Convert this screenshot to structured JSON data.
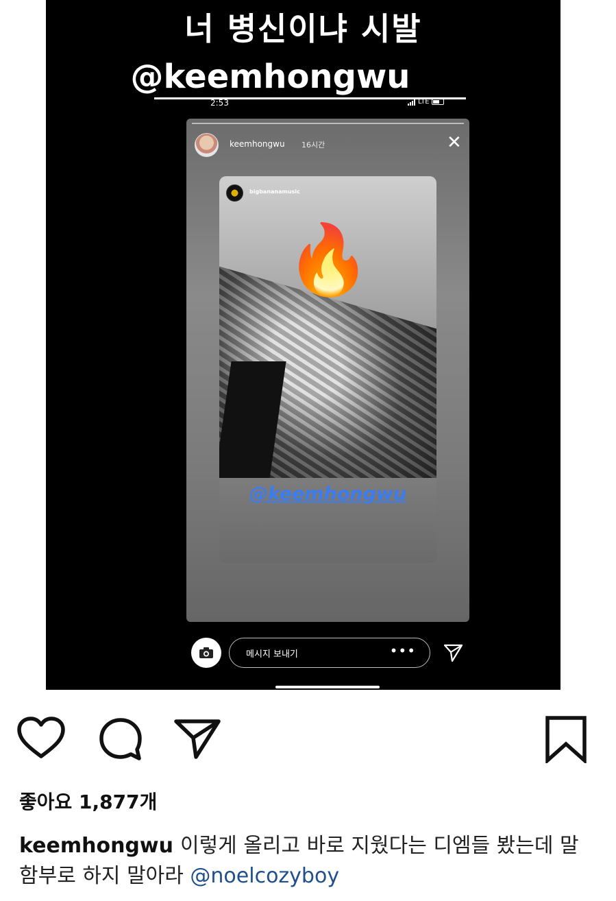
{
  "overlay": {
    "line1": "너 병신이냐 시발",
    "mention": "@keemhongwu"
  },
  "status_bar": {
    "time": "2:53",
    "network": "LTE"
  },
  "story": {
    "username": "keemhongwu",
    "time_ago": "16시간",
    "close_symbol": "✕",
    "shared_post": {
      "username": "bigbananamusic",
      "emoji": "🔥",
      "mention": "@keemhongwu"
    },
    "reply_placeholder": "메시지 보내기",
    "more_symbol": "•••"
  },
  "post": {
    "likes": "좋아요 1,877개",
    "caption_user": "keemhongwu",
    "caption_text": "이렇게 올리고 바로 지웠다는 디엠들 봤는데 말 함부로 하지 말아라",
    "caption_mention": "@noelcozyboy"
  },
  "icons": {
    "like": "heart-icon",
    "comment": "speech-bubble-icon",
    "share": "paper-plane-icon",
    "save": "bookmark-icon",
    "camera": "camera-icon"
  },
  "colors": {
    "mention_blue": "#3b7cf0",
    "caption_mention": "#1f4f8f"
  }
}
